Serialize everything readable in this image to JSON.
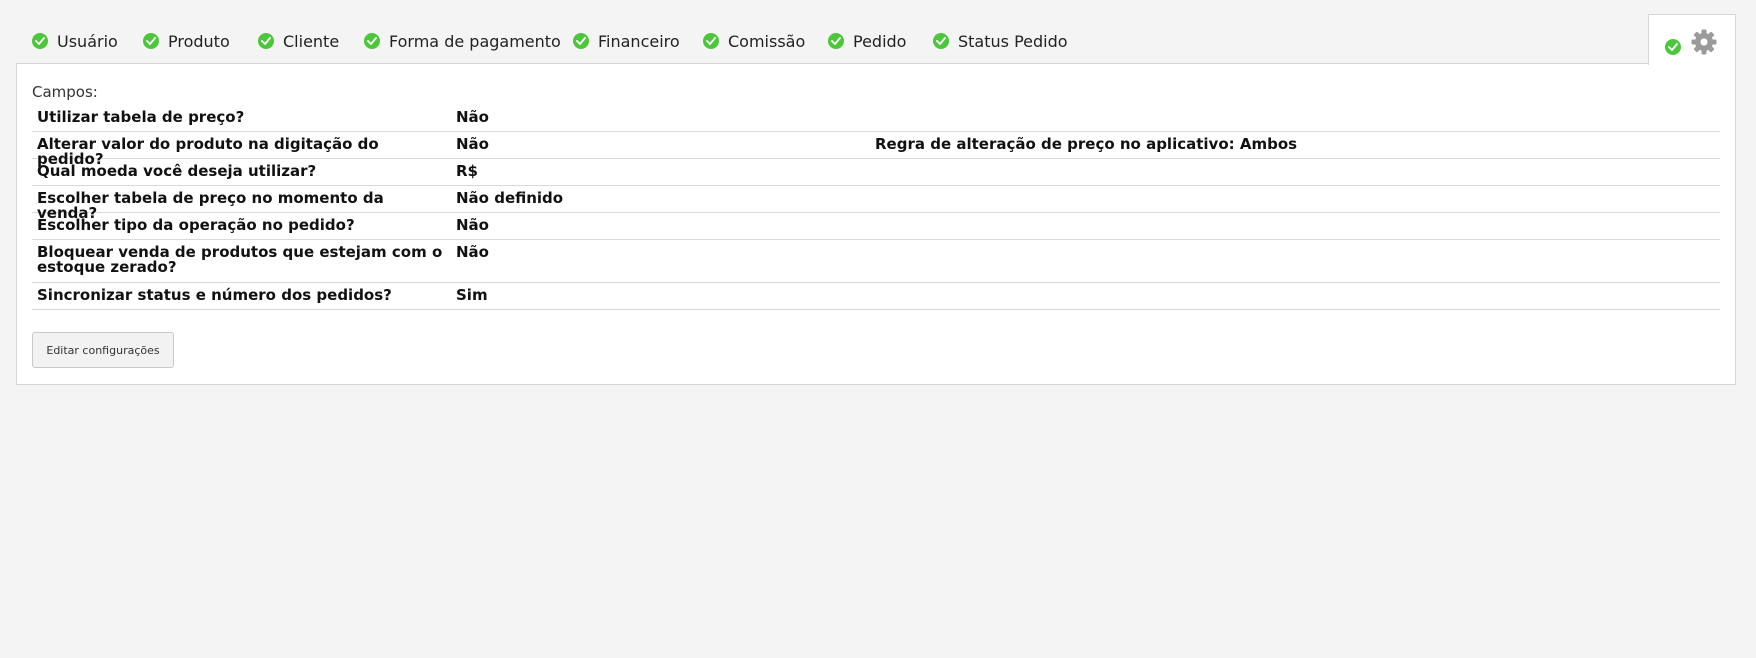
{
  "tabs": [
    {
      "label": "Usuário",
      "icon": "check-circle-icon"
    },
    {
      "label": "Produto",
      "icon": "check-circle-icon"
    },
    {
      "label": "Cliente",
      "icon": "check-circle-icon"
    },
    {
      "label": "Forma de pagamento",
      "icon": "check-circle-icon"
    },
    {
      "label": "Financeiro",
      "icon": "check-circle-icon"
    },
    {
      "label": "Comissão",
      "icon": "check-circle-icon"
    },
    {
      "label": "Pedido",
      "icon": "check-circle-icon"
    },
    {
      "label": "Status Pedido",
      "icon": "check-circle-icon"
    }
  ],
  "active_tab": {
    "icon": "gear-icon",
    "status_icon": "check-circle-icon"
  },
  "panel": {
    "fields_label": "Campos:",
    "rows": [
      {
        "question": "Utilizar tabela de preço?",
        "answer": "Não"
      },
      {
        "question": "Alterar valor do produto na digitação do pedido?",
        "answer": "Não",
        "extra": "Regra de alteração de preço no aplicativo: Ambos"
      },
      {
        "question": "Qual moeda você deseja utilizar?",
        "answer": "R$"
      },
      {
        "question": "Escolher tabela de preço no momento da venda?",
        "answer": "Não definido"
      },
      {
        "question": "Escolher tipo da operação no pedido?",
        "answer": "Não"
      },
      {
        "question": "Bloquear venda de produtos que estejam com o estoque zerado?",
        "answer": "Não"
      },
      {
        "question": "Sincronizar status e número dos pedidos?",
        "answer": "Sim"
      }
    ],
    "edit_button": "Editar configurações"
  },
  "colors": {
    "check": "#4cc63a",
    "gear": "#999999",
    "background": "#f4f4f4",
    "panel": "#ffffff",
    "border": "#d6d6d6"
  }
}
